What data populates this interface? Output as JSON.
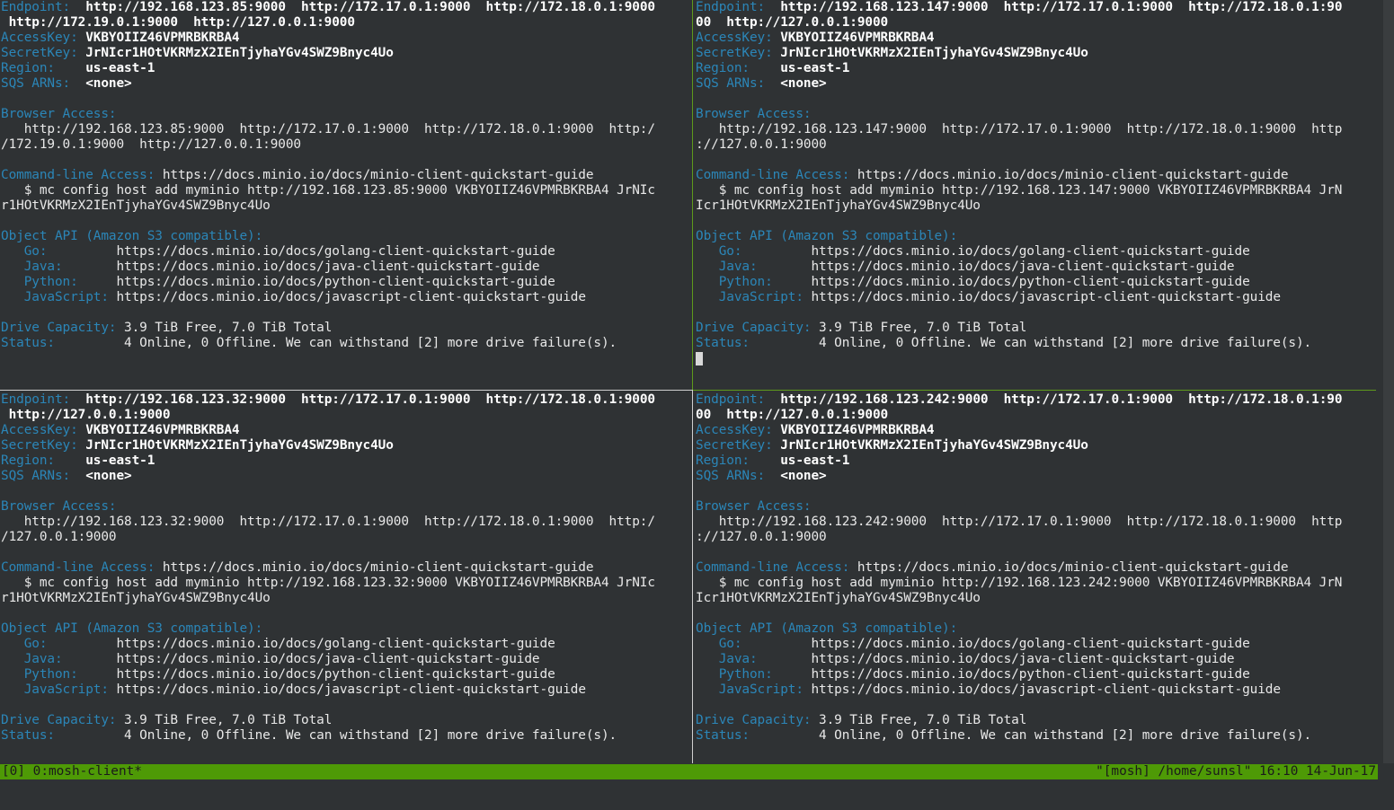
{
  "labels": {
    "endpoint": "Endpoint:",
    "accesskey": "AccessKey:",
    "secretkey": "SecretKey:",
    "region": "Region:",
    "sqs": "SQS ARNs:",
    "browser": "Browser Access:",
    "cmdline": "Command-line Access:",
    "objectapi": "Object API (Amazon S3 compatible):",
    "go": "Go:",
    "java": "Java:",
    "python": "Python:",
    "javascript": "JavaScript:",
    "drive": "Drive Capacity:",
    "status": "Status:"
  },
  "common": {
    "accesskey": "VKBYOIIZ46VPMRBKRBA4",
    "secretkey": "JrNIcr1HOtVKRMzX2IEnTjyhaYGv4SWZ9Bnyc4Uo",
    "region": "us-east-1",
    "sqs": "<none>",
    "cmdline_url": "https://docs.minio.io/docs/minio-client-quickstart-guide",
    "go_url": "https://docs.minio.io/docs/golang-client-quickstart-guide",
    "java_url": "https://docs.minio.io/docs/java-client-quickstart-guide",
    "python_url": "https://docs.minio.io/docs/python-client-quickstart-guide",
    "javascript_url": "https://docs.minio.io/docs/javascript-client-quickstart-guide",
    "drive": "3.9 TiB Free, 7.0 TiB Total",
    "status": "4 Online, 0 Offline. We can withstand [2] more drive failure(s)."
  },
  "panes": {
    "tl": {
      "endpoint_1": "http://192.168.123.85:9000  http://172.17.0.1:9000  http://172.18.0.1:9000",
      "endpoint_2": " http://172.19.0.1:9000  http://127.0.0.1:9000",
      "browser_1": "   http://192.168.123.85:9000  http://172.17.0.1:9000  http://172.18.0.1:9000  http:/",
      "browser_2": "/172.19.0.1:9000  http://127.0.0.1:9000",
      "mc_1": "   $ mc config host add myminio http://192.168.123.85:9000 VKBYOIIZ46VPMRBKRBA4 JrNIc",
      "mc_2": "r1HOtVKRMzX2IEnTjyhaYGv4SWZ9Bnyc4Uo"
    },
    "tr": {
      "endpoint_1": "http://192.168.123.147:9000  http://172.17.0.1:9000  http://172.18.0.1:90",
      "endpoint_2": "00  http://127.0.0.1:9000",
      "browser_1": "   http://192.168.123.147:9000  http://172.17.0.1:9000  http://172.18.0.1:9000  http",
      "browser_2": "://127.0.0.1:9000",
      "mc_1": "   $ mc config host add myminio http://192.168.123.147:9000 VKBYOIIZ46VPMRBKRBA4 JrN",
      "mc_2": "Icr1HOtVKRMzX2IEnTjyhaYGv4SWZ9Bnyc4Uo"
    },
    "bl": {
      "endpoint_1": "http://192.168.123.32:9000  http://172.17.0.1:9000  http://172.18.0.1:9000",
      "endpoint_2": " http://127.0.0.1:9000",
      "browser_1": "   http://192.168.123.32:9000  http://172.17.0.1:9000  http://172.18.0.1:9000  http:/",
      "browser_2": "/127.0.0.1:9000",
      "mc_1": "   $ mc config host add myminio http://192.168.123.32:9000 VKBYOIIZ46VPMRBKRBA4 JrNIc",
      "mc_2": "r1HOtVKRMzX2IEnTjyhaYGv4SWZ9Bnyc4Uo"
    },
    "br": {
      "endpoint_1": "http://192.168.123.242:9000  http://172.17.0.1:9000  http://172.18.0.1:90",
      "endpoint_2": "00  http://127.0.0.1:9000",
      "browser_1": "   http://192.168.123.242:9000  http://172.17.0.1:9000  http://172.18.0.1:9000  http",
      "browser_2": "://127.0.0.1:9000",
      "mc_1": "   $ mc config host add myminio http://192.168.123.242:9000 VKBYOIIZ46VPMRBKRBA4 JrN",
      "mc_2": "Icr1HOtVKRMzX2IEnTjyhaYGv4SWZ9Bnyc4Uo"
    }
  },
  "statusbar": {
    "left": "[0] 0:mosh-client*",
    "right": "\"[mosh] /home/sunsl\" 16:10 14-Jun-17"
  },
  "colors": {
    "label": "#2b86b8",
    "accent_green": "#4e9a06",
    "background": "#2f3234"
  }
}
